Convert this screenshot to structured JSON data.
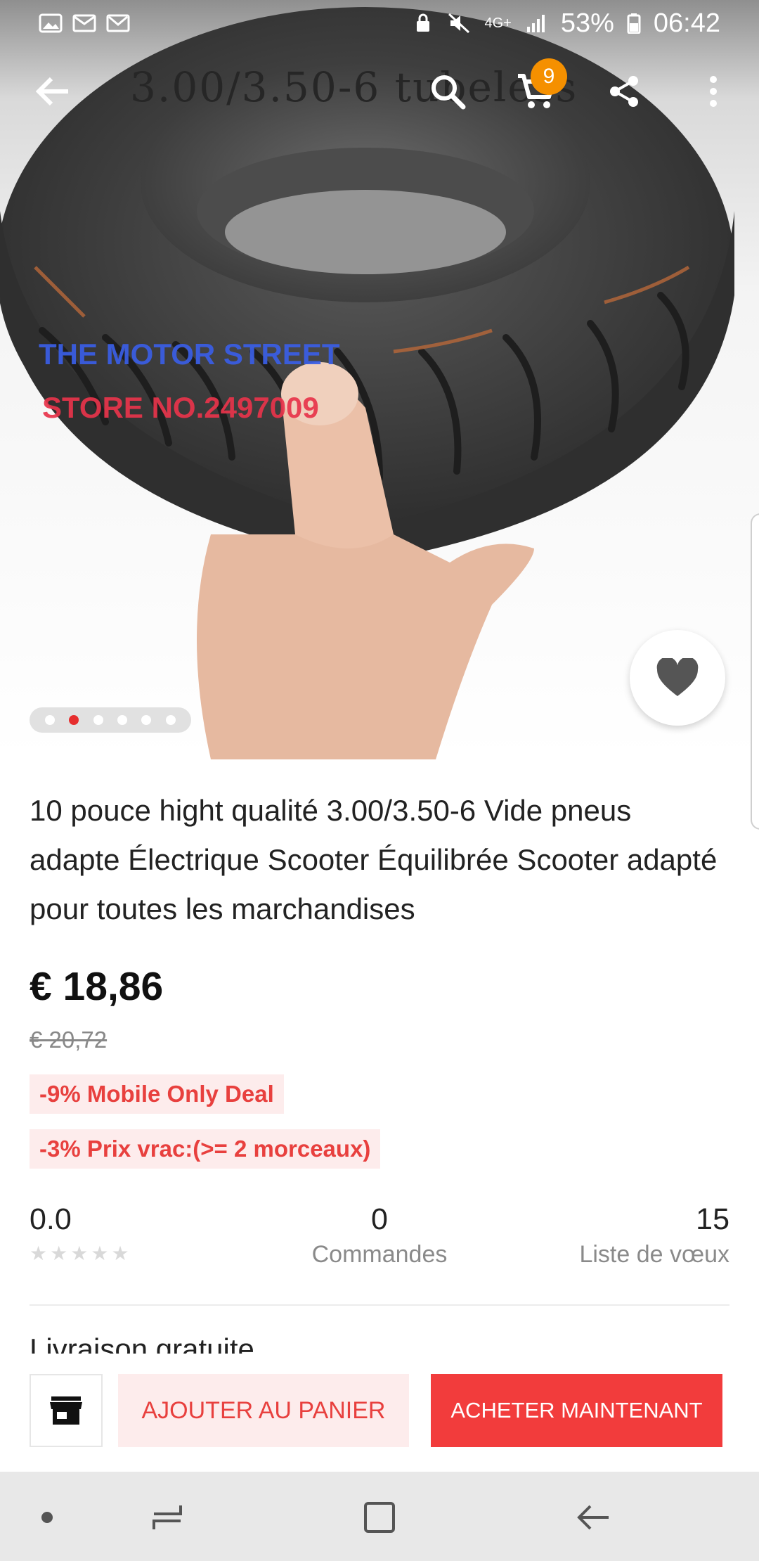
{
  "status_bar": {
    "battery": "53%",
    "time": "06:42",
    "network": "4G+"
  },
  "toolbar": {
    "cart_count": "9"
  },
  "gallery": {
    "caption": "3.00/3.50-6 tubeless",
    "watermark_line1": "THE MOTOR STREET",
    "watermark_line2": "STORE NO.2497009",
    "active_index": 2,
    "total": 6
  },
  "product": {
    "title": "10 pouce hight qualité 3.00/3.50-6 Vide pneus adapte Électrique Scooter Équilibrée Scooter adapté pour toutes les marchandises",
    "price": "€ 18,86",
    "old_price": "€ 20,72",
    "promo_1": "-9% Mobile Only Deal",
    "promo_2": "-3% Prix vrac:(>= 2 morceaux)"
  },
  "stats": {
    "rating": "0.0",
    "orders": "0",
    "orders_label": "Commandes",
    "wishlist": "15",
    "wishlist_label": "Liste de vœux"
  },
  "shipping": {
    "label": "Livraison gratuite"
  },
  "actions": {
    "add_to_cart": "AJOUTER AU PANIER",
    "buy_now": "ACHETER MAINTENANT"
  },
  "colors": {
    "accent_red": "#f23c3c",
    "badge_orange": "#f59000",
    "promo_bg": "#fdecec"
  }
}
